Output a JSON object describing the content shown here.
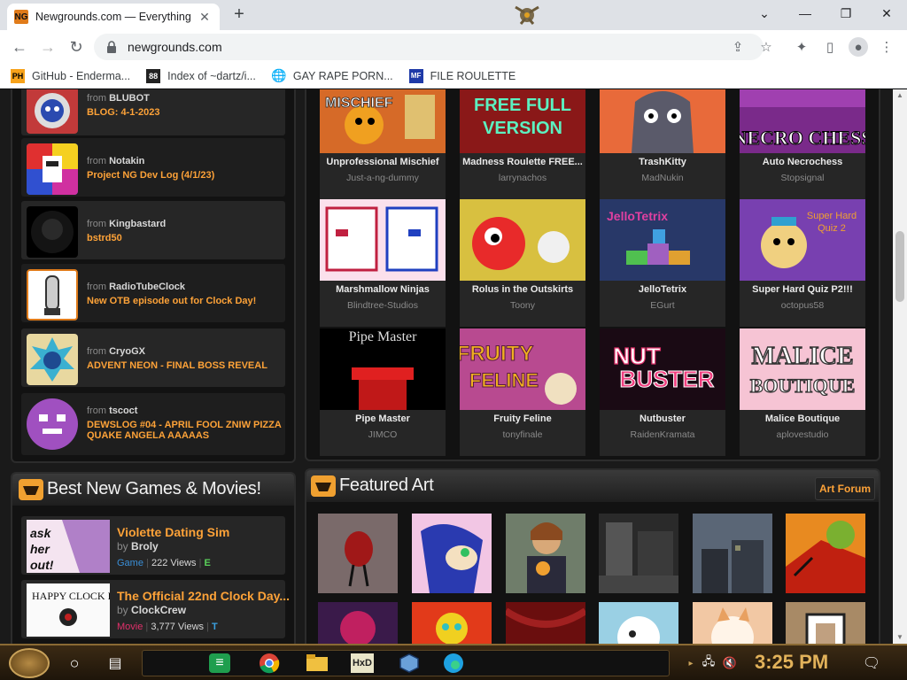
{
  "browser": {
    "tab_title": "Newgrounds.com — Everything",
    "tab_favicon": "NG",
    "url": "newgrounds.com",
    "bookmarks": [
      {
        "icon": "PH",
        "label": "GitHub - Enderma..."
      },
      {
        "icon": "88",
        "label": "Index of ~dartz/i..."
      },
      {
        "icon": "globe",
        "label": "GAY RAPE PORN..."
      },
      {
        "icon": "MF",
        "label": "FILE ROULETTE"
      }
    ]
  },
  "feed": {
    "from_prefix": "from",
    "items": [
      {
        "user": "BLUBOT",
        "message": "BLOG: 4-1-2023"
      },
      {
        "user": "Notakin",
        "message": "Project NG Dev Log (4/1/23)"
      },
      {
        "user": "Kingbastard",
        "message": "bstrd50"
      },
      {
        "user": "RadioTubeClock",
        "message": "New OTB episode out for Clock Day!"
      },
      {
        "user": "CryoGX",
        "message": "ADVENT NEON - FINAL BOSS REVEAL"
      },
      {
        "user": "tscoct",
        "message": "DEWSLOG #04 - APRIL FOOL ZNIW PIZZA QUAKE ANGELA AAAAAS"
      }
    ]
  },
  "games": [
    {
      "title": "Unprofessional Mischief",
      "author": "Just-a-ng-dummy",
      "art_text": "MISCHIEF"
    },
    {
      "title": "Madness Roulette FREE...",
      "author": "larrynachos",
      "art_text": "FREE FULL VERSION"
    },
    {
      "title": "TrashKitty",
      "author": "MadNukin",
      "art_text": ""
    },
    {
      "title": "Auto Necrochess",
      "author": "Stopsignal",
      "art_text": "NECRO CHESS"
    },
    {
      "title": "Marshmallow Ninjas",
      "author": "Blindtree-Studios",
      "art_text": ""
    },
    {
      "title": "Rolus in the Outskirts",
      "author": "Toony",
      "art_text": ""
    },
    {
      "title": "JelloTetrix",
      "author": "EGurt",
      "art_text": "JelloTetrix"
    },
    {
      "title": "Super Hard Quiz P2!!!",
      "author": "octopus58",
      "art_text": "Super Hard Quiz 2"
    },
    {
      "title": "Pipe Master",
      "author": "JIMCO",
      "art_text": "Pipe Master"
    },
    {
      "title": "Fruity Feline",
      "author": "tonyfinale",
      "art_text": "FRUITY FELINE"
    },
    {
      "title": "Nutbuster",
      "author": "RaidenKramata",
      "art_text": "NUT BUSTER"
    },
    {
      "title": "Malice Boutique",
      "author": "aplovestudio",
      "art_text": "MALICE BOUTIQUE"
    }
  ],
  "best_new": {
    "heading": "Best New Games & Movies!",
    "items": [
      {
        "title": "Violette Dating Sim",
        "by_label": "by",
        "author": "Broly",
        "type": "Game",
        "type_color": "#3a8fd8",
        "views": "222 Views",
        "rating_icon": "E"
      },
      {
        "title": "The Official 22nd Clock Day...",
        "by_label": "by",
        "author": "ClockCrew",
        "type": "Movie",
        "type_color": "#e0306a",
        "views": "3,777 Views",
        "rating_icon": "T"
      }
    ]
  },
  "featured_art": {
    "heading": "Featured Art",
    "forum_label": "Art Forum"
  },
  "taskbar": {
    "clock": "3:25 PM"
  },
  "colors": {
    "accent": "#fda238",
    "panel": "#121212",
    "card": "#262626"
  }
}
